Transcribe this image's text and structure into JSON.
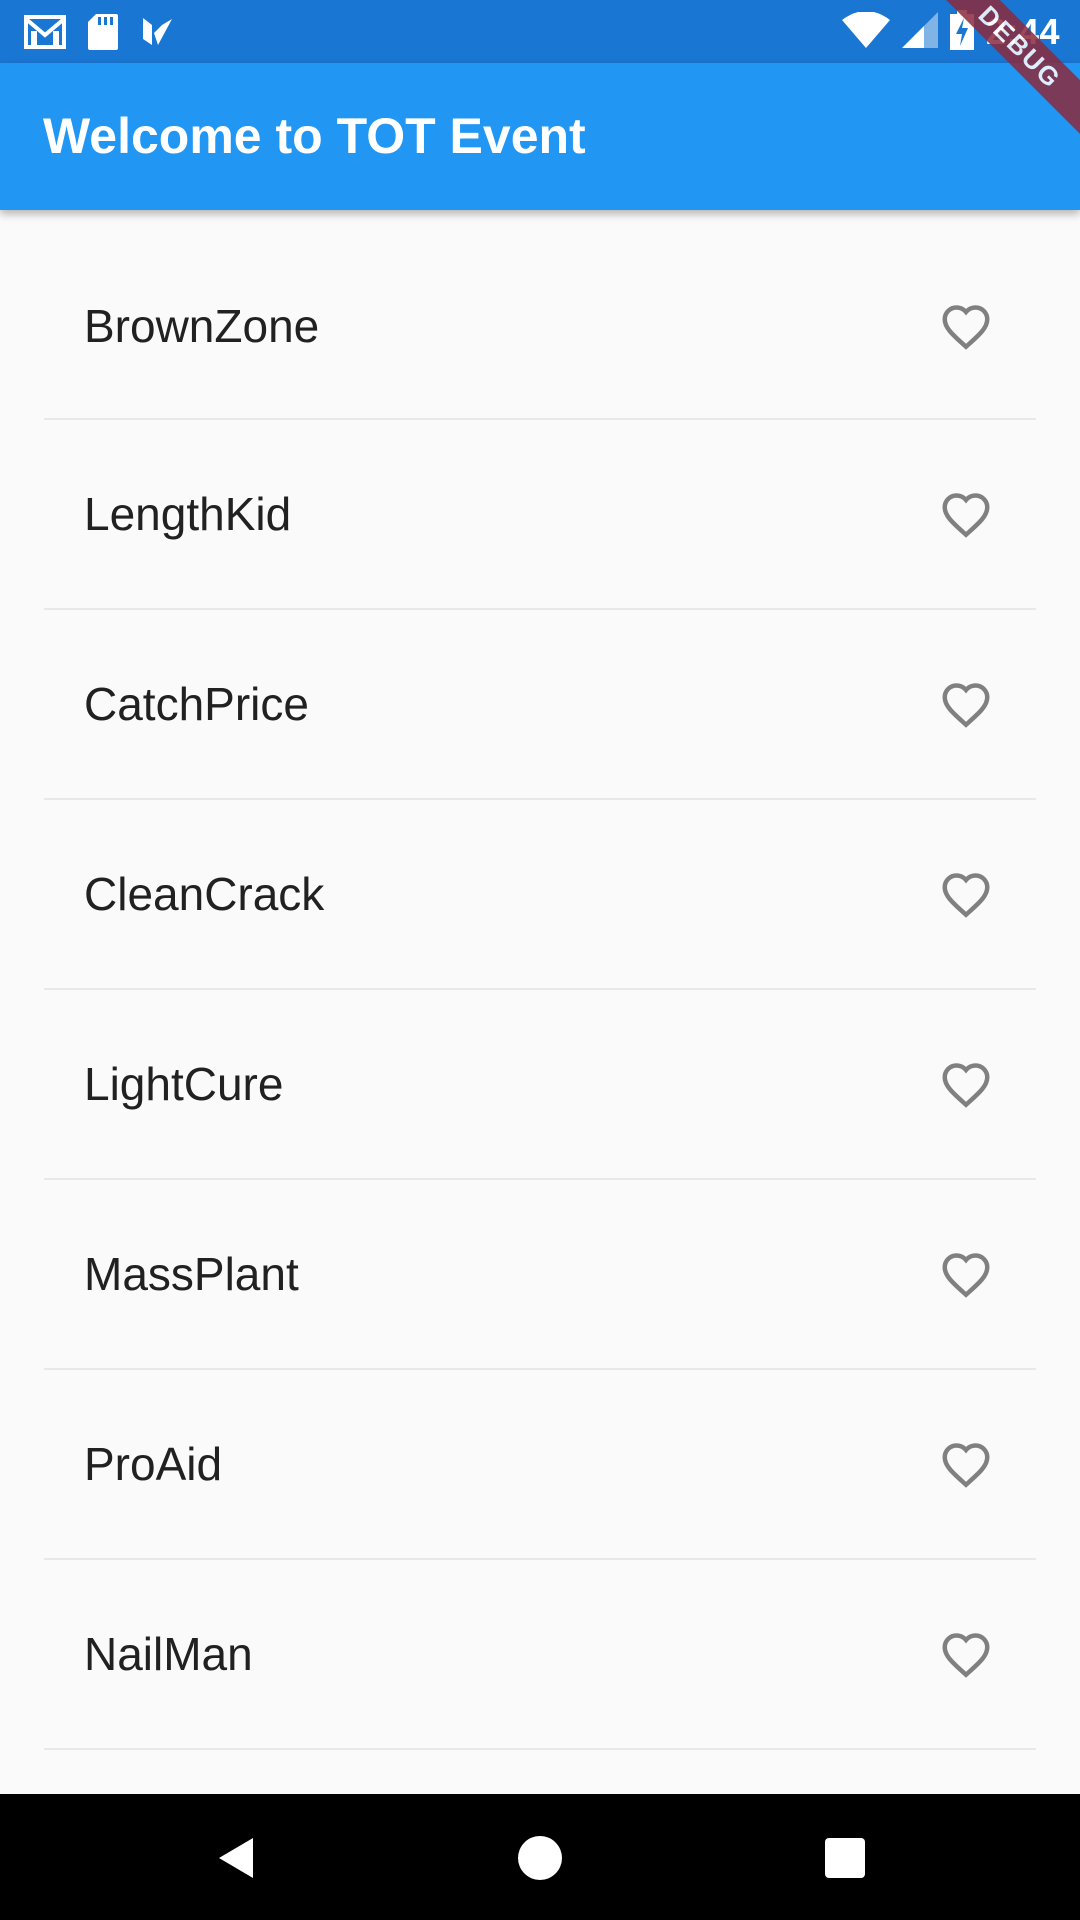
{
  "status_bar": {
    "time": "2:44",
    "left_icons": [
      "gmail-icon",
      "sd-card-icon",
      "play-store-icon"
    ],
    "right_icons": [
      "wifi-icon",
      "cell-signal-icon",
      "battery-charging-icon"
    ]
  },
  "debug_banner": {
    "label": "DEBUG",
    "color": "#8b2a3e"
  },
  "app_bar": {
    "title": "Welcome to TOT Event",
    "color": "#2196f3",
    "status_color": "#1976d2"
  },
  "list": {
    "items": [
      {
        "label": "BrownZone",
        "favorite": false
      },
      {
        "label": "LengthKid",
        "favorite": false
      },
      {
        "label": "CatchPrice",
        "favorite": false
      },
      {
        "label": "CleanCrack",
        "favorite": false
      },
      {
        "label": "LightCure",
        "favorite": false
      },
      {
        "label": "MassPlant",
        "favorite": false
      },
      {
        "label": "ProAid",
        "favorite": false
      },
      {
        "label": "NailMan",
        "favorite": false
      }
    ],
    "favorite_icon": "heart-outline-icon",
    "icon_color": "#808080"
  },
  "nav_bar": {
    "buttons": [
      "back-icon",
      "home-icon",
      "recents-icon"
    ]
  }
}
